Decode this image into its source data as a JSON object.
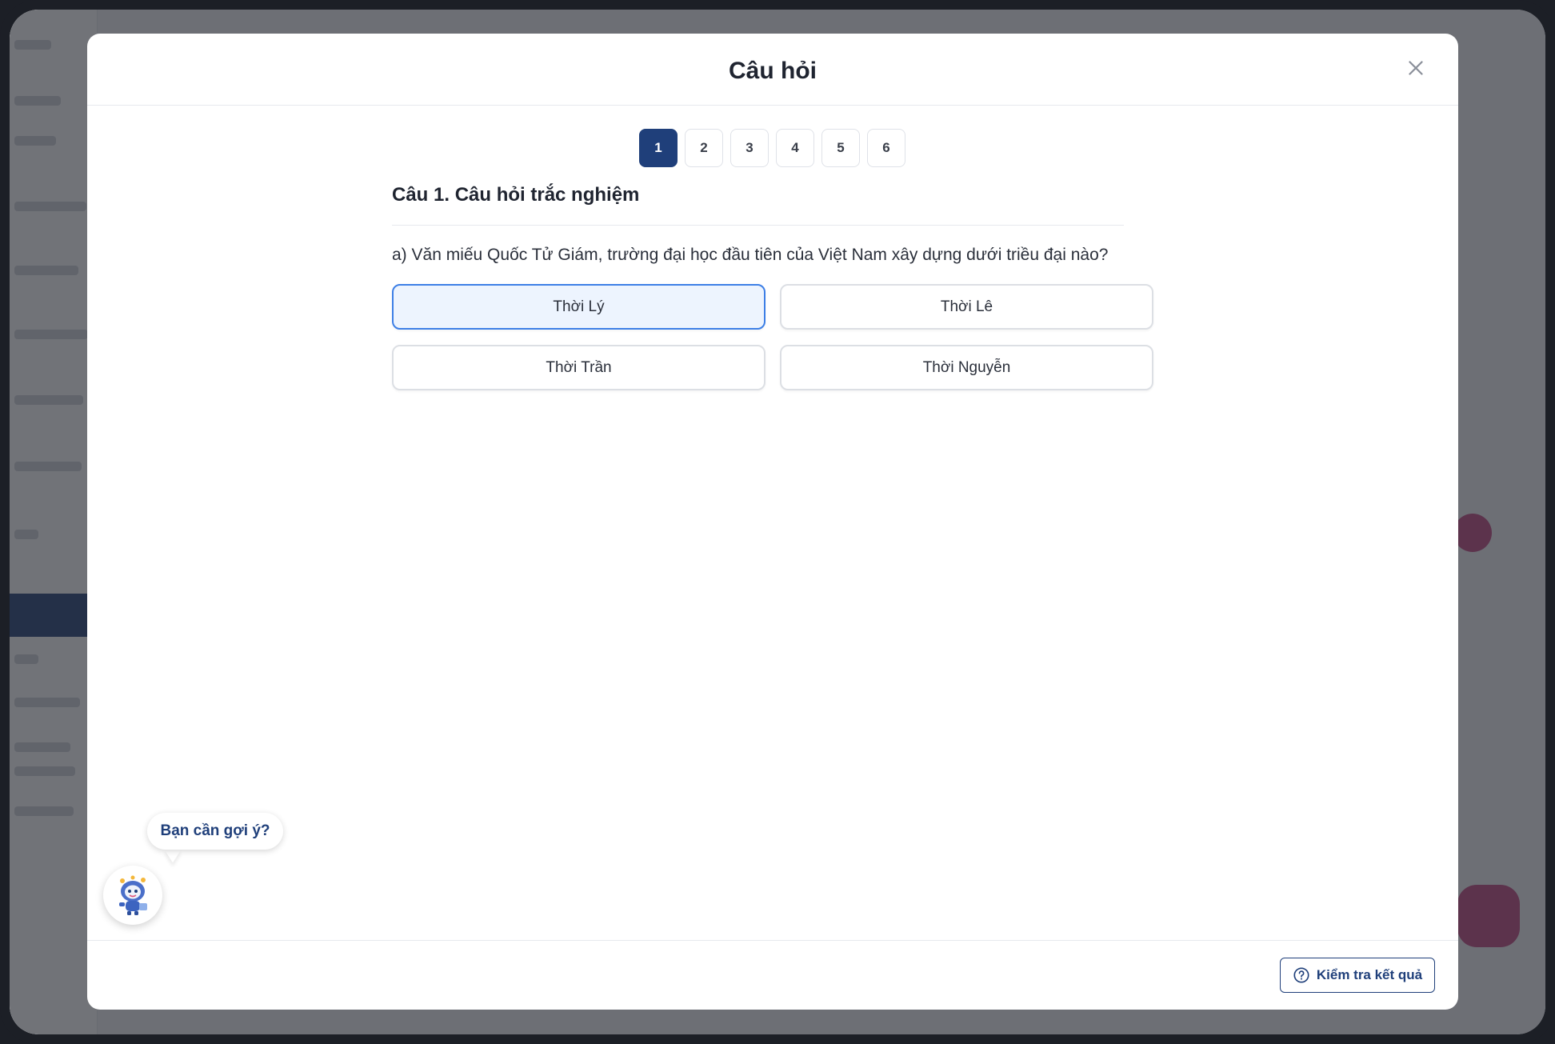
{
  "modal": {
    "title": "Câu hỏi",
    "close_icon": "close-icon"
  },
  "pager": {
    "pages": [
      "1",
      "2",
      "3",
      "4",
      "5",
      "6"
    ],
    "active": "1"
  },
  "question": {
    "heading": "Câu 1. Câu hỏi trắc nghiệm",
    "text": "a) Văn miếu Quốc Tử Giám, trường đại học đầu tiên của Việt Nam xây dựng dưới triều đại nào?",
    "options": [
      {
        "label": "Thời Lý",
        "selected": true
      },
      {
        "label": "Thời Lê",
        "selected": false
      },
      {
        "label": "Thời Trần",
        "selected": false
      },
      {
        "label": "Thời Nguyễn",
        "selected": false
      }
    ]
  },
  "hint": {
    "bubble_text": "Bạn cần gợi ý?",
    "mascot_icon": "robot-mascot-icon"
  },
  "footer": {
    "check_button": "Kiểm tra kết quả",
    "check_icon": "question-circle-icon"
  },
  "colors": {
    "primary": "#1f3f7a",
    "selected_border": "#3d7fe6",
    "selected_bg": "#edf4fe"
  }
}
